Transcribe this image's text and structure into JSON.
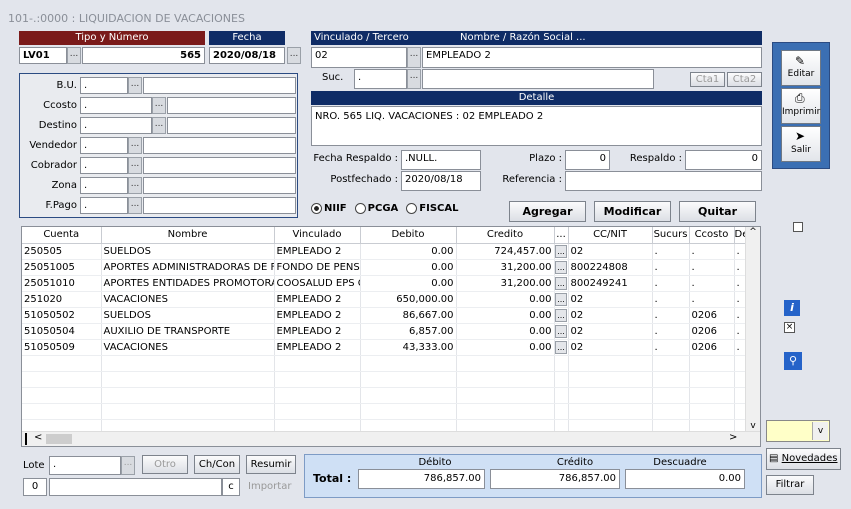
{
  "window": {
    "title": "101-.:0000 : LIQUIDACION DE VACACIONES"
  },
  "doc": {
    "tipo_header": "Tipo y Número",
    "tipo": "LV01",
    "numero": "565",
    "fecha_header": "Fecha",
    "fecha": "2020/08/18"
  },
  "tercero": {
    "vinculado_header": "Vinculado / Tercero",
    "nombre_header": "Nombre / Razón Social ...",
    "vinculado": "02",
    "nombre": "EMPLEADO 2",
    "suc_label": "Suc.",
    "suc": ".",
    "cta1": "Cta1",
    "cta2": "Cta2"
  },
  "left_fields": [
    {
      "label": "B.U.",
      "value": "."
    },
    {
      "label": "Ccosto",
      "value": "."
    },
    {
      "label": "Destino",
      "value": "."
    },
    {
      "label": "Vendedor",
      "value": "."
    },
    {
      "label": "Cobrador",
      "value": "."
    },
    {
      "label": "Zona",
      "value": "."
    },
    {
      "label": "F.Pago",
      "value": "."
    }
  ],
  "detalle": {
    "header": "Detalle",
    "text": "NRO. 565 LIQ. VACACIONES : 02 EMPLEADO 2"
  },
  "info": {
    "fecha_respaldo_label": "Fecha Respaldo :",
    "fecha_respaldo": ".NULL.",
    "plazo_label": "Plazo :",
    "plazo": "0",
    "respaldo_label": "Respaldo :",
    "respaldo": "0",
    "postfechado_label": "Postfechado :",
    "postfechado": "2020/08/18",
    "referencia_label": "Referencia :",
    "referencia": ""
  },
  "radios": {
    "niif": "NIIF",
    "pcga": "PCGA",
    "fiscal": "FISCAL"
  },
  "actions": {
    "agregar": "Agregar",
    "modificar": "Modificar",
    "quitar": "Quitar"
  },
  "side": {
    "editar": "Editar",
    "imprimir": "Imprimir",
    "salir": "Salir",
    "novedades": "Novedades",
    "filtrar": "Filtrar"
  },
  "grid": {
    "columns": [
      "Cuenta",
      "Nombre",
      "Vinculado",
      "Debito",
      "Credito",
      "...",
      "CC/NIT",
      "Sucurs",
      "Ccosto",
      "De"
    ],
    "rows": [
      [
        "250505",
        "SUELDOS",
        "EMPLEADO 2",
        "0.00",
        "724,457.00",
        "02",
        ".",
        ".",
        "."
      ],
      [
        "25051005",
        "APORTES ADMINISTRADORAS DE F",
        "FONDO DE PENSI",
        "0.00",
        "31,200.00",
        "800224808",
        ".",
        ".",
        "."
      ],
      [
        "25051010",
        "APORTES ENTIDADES PROMOTORA",
        "COOSALUD EPS C",
        "0.00",
        "31,200.00",
        "800249241",
        ".",
        ".",
        "."
      ],
      [
        "251020",
        "VACACIONES",
        "EMPLEADO 2",
        "650,000.00",
        "0.00",
        "02",
        ".",
        ".",
        "."
      ],
      [
        "51050502",
        "SUELDOS",
        "EMPLEADO 2",
        "86,667.00",
        "0.00",
        "02",
        ".",
        "0206",
        "."
      ],
      [
        "51050504",
        "AUXILIO DE TRANSPORTE",
        "EMPLEADO 2",
        "6,857.00",
        "0.00",
        "02",
        ".",
        "0206",
        "."
      ],
      [
        "51050509",
        "VACACIONES",
        "EMPLEADO 2",
        "43,333.00",
        "0.00",
        "02",
        ".",
        "0206",
        "."
      ]
    ]
  },
  "bottom": {
    "lote_label": "Lote",
    "lote": ".",
    "otro": "Otro",
    "chcon": "Ch/Con",
    "resumir": "Resumir",
    "num": "0",
    "c": "c",
    "importar": "Importar"
  },
  "totals": {
    "debito_label": "Débito",
    "credito_label": "Crédito",
    "descuadre_label": "Descuadre",
    "total_label": "Total :",
    "debito": "786,857.00",
    "credito": "786,857.00",
    "descuadre": "0.00"
  }
}
